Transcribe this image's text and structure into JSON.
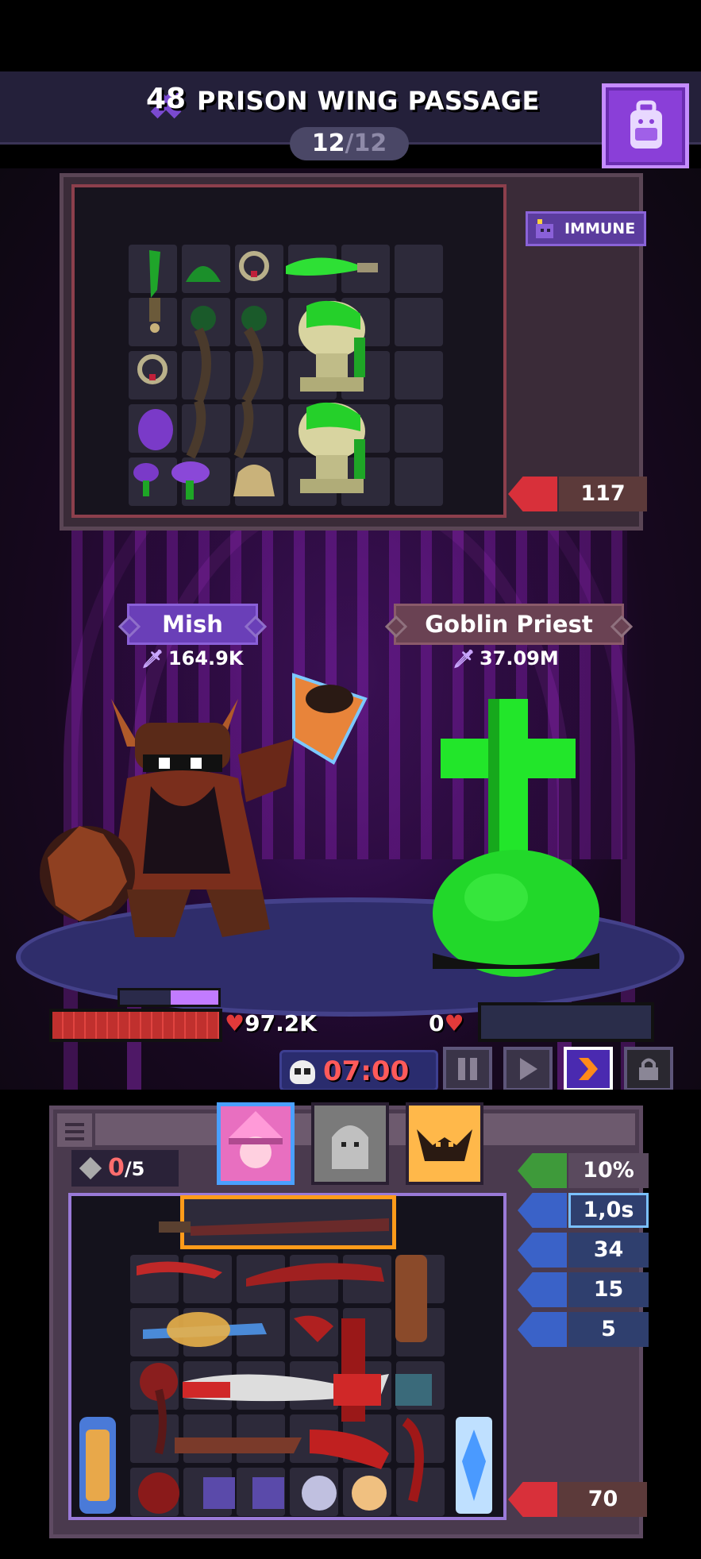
{
  "header": {
    "level": "48",
    "zone_title": "PRISON WING PASSAGE",
    "wave_current": "12",
    "wave_separator": "/",
    "wave_total": "12",
    "backpack_icon": "backpack-icon"
  },
  "enemy_inventory": {
    "badge_label": "IMMUNE",
    "badge_icon": "immune-icon",
    "gold_value": "117",
    "gold_icon": "coin-bag-icon"
  },
  "player": {
    "name": "Mish",
    "power": "164.9K",
    "hp": "97.2K",
    "hp_fraction": 1.0,
    "shield_fraction": 0.48
  },
  "enemy": {
    "name": "Goblin Priest",
    "power": "37.09M",
    "hp": "0",
    "hp_fraction": 0.0
  },
  "battle": {
    "timer": "07:00",
    "controls": [
      {
        "name": "pause-button",
        "icon": "pause-icon",
        "active": false
      },
      {
        "name": "play-button",
        "icon": "play-icon",
        "active": false
      },
      {
        "name": "fast-forward-button",
        "icon": "fast-forward-icon",
        "active": true
      },
      {
        "name": "lock-button",
        "icon": "lock-icon",
        "active": false
      }
    ]
  },
  "player_inventory": {
    "slots_current": "0",
    "slots_max": "/5",
    "stats": [
      {
        "name": "heal-stat",
        "icon": "heal-plus-icon",
        "value": "10%",
        "color": "#3e9a3a"
      },
      {
        "name": "cooldown-stat",
        "icon": "helmet-icon",
        "value": "1,0s",
        "color": "#3a62c8"
      },
      {
        "name": "damage-stat",
        "icon": "skull-red-icon",
        "value": "34",
        "color": "#3a62c8"
      },
      {
        "name": "crit-stat",
        "icon": "crossed-swords-icon",
        "value": "15",
        "color": "#3a62c8"
      },
      {
        "name": "regen-stat",
        "icon": "heart-shield-icon",
        "value": "5",
        "color": "#3a62c8"
      }
    ],
    "gold_value": "70",
    "gold_icon": "coin-bag-icon"
  },
  "colors": {
    "accent_purple": "#8a3fd8",
    "timer_red": "#ff5a5a",
    "hp_red": "#c0302e",
    "selected_blue": "#4aa0ff",
    "highlight_orange": "#ff9b1a"
  }
}
